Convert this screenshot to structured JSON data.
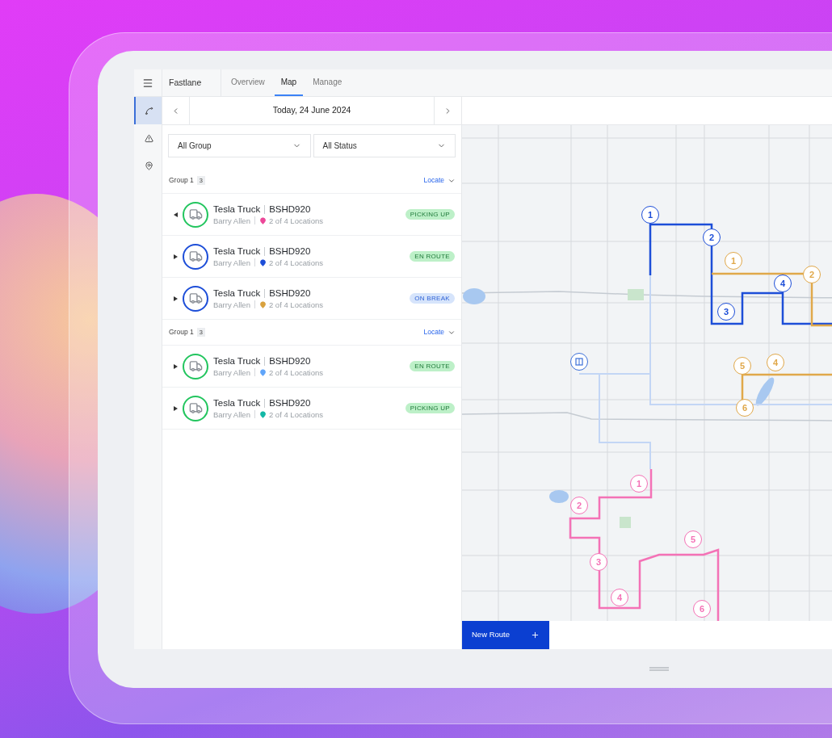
{
  "app": {
    "title": "Fastlane"
  },
  "rail": [
    {
      "kind": "menu",
      "selected": false
    },
    {
      "kind": "route",
      "selected": true
    },
    {
      "kind": "alert",
      "selected": false
    },
    {
      "kind": "location",
      "selected": false
    }
  ],
  "tabs": [
    {
      "label": "Overview",
      "selected": false
    },
    {
      "label": "Map",
      "selected": true
    },
    {
      "label": "Manage",
      "selected": false
    }
  ],
  "date_nav": {
    "label": "Today, 24 June 2024"
  },
  "filters": [
    {
      "value": "All Group"
    },
    {
      "value": "All Status"
    }
  ],
  "groups": [
    {
      "name": "Group 1",
      "count": "3",
      "action": "Locate",
      "vehicles": [
        {
          "name": "Tesla Truck",
          "plate": "BSHD920",
          "driver": "Barry Allen",
          "location": {
            "label": "2 of 4 Locations",
            "color": "#ec4899"
          },
          "expanded": true,
          "color": "#22c55e",
          "status": {
            "label": "PICKING UP",
            "kind": "active"
          }
        },
        {
          "name": "Tesla Truck",
          "plate": "BSHD920",
          "driver": "Barry Allen",
          "location": {
            "label": "2 of 4 Locations",
            "color": "#1d4ed8"
          },
          "expanded": false,
          "color": "#1d4ed8",
          "status": {
            "label": "EN ROUTE",
            "kind": "active"
          }
        },
        {
          "name": "Tesla Truck",
          "plate": "BSHD920",
          "driver": "Barry Allen",
          "location": {
            "label": "2 of 4 Locations",
            "color": "#d9a23f"
          },
          "expanded": false,
          "color": "#1d4ed8",
          "status": {
            "label": "ON BREAK",
            "kind": "break"
          }
        }
      ]
    },
    {
      "name": "Group 1",
      "count": "3",
      "action": "Locate",
      "vehicles": [
        {
          "name": "Tesla Truck",
          "plate": "BSHD920",
          "driver": "Barry Allen",
          "location": {
            "label": "2 of 4 Locations",
            "color": "#60a5fa"
          },
          "expanded": false,
          "color": "#22c55e",
          "status": {
            "label": "EN ROUTE",
            "kind": "active"
          }
        },
        {
          "name": "Tesla Truck",
          "plate": "BSHD920",
          "driver": "Barry Allen",
          "location": {
            "label": "2 of 4 Locations",
            "color": "#14b8a6"
          },
          "expanded": false,
          "color": "#22c55e",
          "status": {
            "label": "PICKING UP",
            "kind": "active"
          }
        }
      ]
    }
  ],
  "map": {
    "routes": [
      {
        "color": "#1d4ed8",
        "stops": [
          "1",
          "2",
          "3",
          "4"
        ]
      },
      {
        "color": "#e0a84a",
        "stops": [
          "1",
          "2",
          "4",
          "5",
          "6"
        ]
      },
      {
        "color": "#f472b6",
        "stops": [
          "1",
          "2",
          "3",
          "4",
          "5",
          "6"
        ]
      }
    ]
  },
  "new_route_button": {
    "label": "New Route"
  }
}
